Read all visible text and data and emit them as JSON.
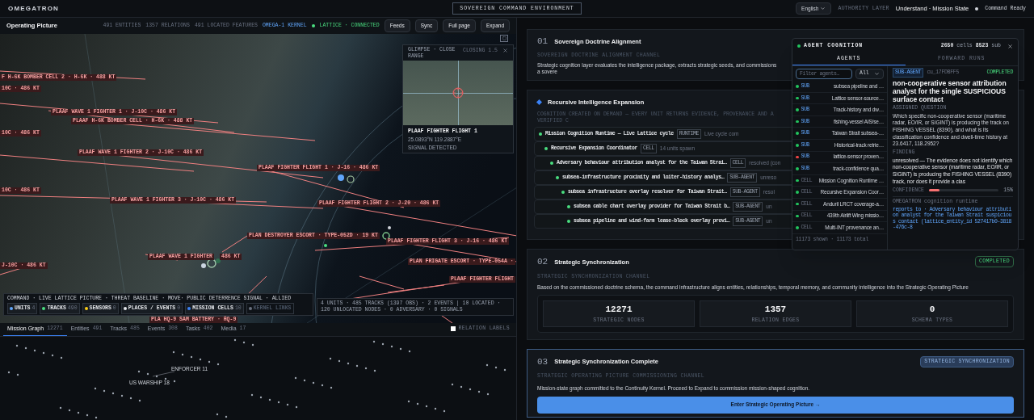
{
  "app": {
    "name": "OMEGATRON",
    "environment": "SOVEREIGN COMMAND ENVIRONMENT",
    "language": "English",
    "authority_label": "AUTHORITY LAYER",
    "authority_value": "Understand · Mission State",
    "status": "Command Ready"
  },
  "operating_picture": {
    "title": "Operating Picture",
    "stats": [
      "491 ENTITIES",
      "1357 RELATIONS",
      "491 LOCATED FEATURES"
    ],
    "kernel": "OMEGA-1 KERNEL",
    "lattice": "LATTICE · CONNECTED",
    "buttons": [
      "Feeds",
      "Sync",
      "Full page",
      "Expand"
    ]
  },
  "map": {
    "track_labels": [
      "F H-6K BOMBER CELL 2 · H-6K · 488 KT",
      "10C · 486 KT",
      "PLAAF WAVE 1 FIGHTER 1 · J-10C · 486 KT",
      "PLAAF H-6K BOMBER CELL · H-6K · 488 KT",
      "10C · 486 KT",
      "PLAAF WAVE 1 FIGHTER 2 · J-10C · 486 KT",
      "PLAAF FIGHTER FLIGHT 1 · J-16 · 486 KT",
      "10C · 486 KT",
      "PLAAF WAVE 1 FIGHTER 3 · J-10C · 486 KT",
      "PLAAF FIGHTER FLIGHT 2 · J-20 · 486 KT",
      "PLAN DESTROYER ESCORT · TYPE-052D · 19 KT",
      "PLAAF FIGHTER FLIGHT 3 · J-16 · 486 KT",
      "PLAAF WAVE 1 FIGHTER",
      "486 KT",
      "PLAN FRIGATE ESCORT · TYPE-054A ·",
      "PLAAF FIGHTER FLIGHT",
      "J-10C · 486 KT",
      "PLA HQ-9 SAM BATTERY · HQ-9"
    ],
    "glimpse": {
      "title": "GLIMPSE · CLOSE RANGE",
      "closing": "CLOSING 1.5",
      "target": "PLAAF FIGHTER FLIGHT 1",
      "coords": "25.0893°N 119.2887°E",
      "signal": "SIGNAL DETECTED"
    },
    "legend": {
      "banner": "COMMAND · LIVE LATTICE PICTURE · THREAT BASELINE · MOVE· PUBLIC DETERRENCE SIGNAL · ALLIED",
      "chips": [
        {
          "label": "UNITS",
          "count": "4",
          "color": "#60a5fa",
          "enabled": true
        },
        {
          "label": "TRACKS",
          "count": "490",
          "color": "#4ade80",
          "enabled": true
        },
        {
          "label": "SENSORS",
          "count": "0",
          "color": "#facc15",
          "enabled": true
        },
        {
          "label": "PLACES / EVENTS",
          "count": "0",
          "color": "#e5e7eb",
          "enabled": true
        },
        {
          "label": "MISSION CELLS",
          "count": "10",
          "color": "#3b82f6",
          "enabled": true
        },
        {
          "label": "KERNEL LINKS",
          "color": "#6b7280",
          "enabled": false
        }
      ],
      "summary": "4 UNITS · 485 TRACKS (1397 OBS) · 2 EVENTS | 10 LOCATED · 120 UNLOCATED NODES · 0 ADVERSARY · 0 SIGNALS"
    }
  },
  "graph": {
    "tabs": [
      {
        "label": "Mission Graph",
        "count": "12271",
        "selected": true
      },
      {
        "label": "Entities",
        "count": "491",
        "selected": false
      },
      {
        "label": "Tracks",
        "count": "485",
        "selected": false
      },
      {
        "label": "Events",
        "count": "308",
        "selected": false
      },
      {
        "label": "Tasks",
        "count": "402",
        "selected": false
      },
      {
        "label": "Media",
        "count": "17",
        "selected": false
      }
    ],
    "relation_labels": {
      "label": "RELATION LABELS",
      "checked": false
    },
    "node_labels": [
      "ENFORCER 11",
      "US WARSHIP 18"
    ]
  },
  "doctrine": {
    "number": "01",
    "title": "Sovereign Doctrine Alignment",
    "channel": "SOVEREIGN DOCTRINE ALIGNMENT CHANNEL",
    "text": "Strategic cognition layer evaluates the intelligence package, extracts strategic seeds, and commissions a sovere"
  },
  "expansion": {
    "title": "Recursive Intelligence Expansion",
    "subtitle": "COGNITION CREATED ON DEMAND — EVERY UNIT RETURNS EVIDENCE, PROVENANCE AND A VERIFIED C",
    "tree": [
      {
        "name": "Mission Cognition Runtime — Live Lattice cycle",
        "badge": "RUNTIME",
        "status": "Live cycle com",
        "children": [
          {
            "name": "Recursive Expansion Coordinator",
            "badge": "CELL",
            "status": "14 units spawn",
            "children": [
              {
                "name": "Adversary behaviour attribution analyst for the Taiwan Strai…",
                "badge": "CELL",
                "status": "resolved (con",
                "children": [
                  {
                    "name": "subsea-infrastructure proximity and loiter-history analys…",
                    "badge": "SUB-AGENT",
                    "status": "unreso",
                    "children": [
                      {
                        "name": "subsea infrastructure overlay resolver for Taiwan Strait…",
                        "badge": "SUB-AGENT",
                        "status": "resol",
                        "children": [
                          {
                            "name": "subsea cable chart overlay provider for Taiwan Strait b…",
                            "badge": "SUB-AGENT",
                            "status": "un"
                          },
                          {
                            "name": "subsea pipeline and wind-farm lease-block overlay provi…",
                            "badge": "SUB-AGENT",
                            "status": "un"
                          }
                        ]
                      }
                    ]
                  }
                ]
              }
            ]
          }
        ]
      }
    ]
  },
  "agent_cognition": {
    "title": "AGENT COGNITION",
    "cells": "2650",
    "cells_label": "cells",
    "sub": "8523",
    "sub_label": "sub",
    "tabs": [
      {
        "label": "AGENTS",
        "selected": true
      },
      {
        "label": "FORWARD RUNS",
        "selected": false
      }
    ],
    "filter": {
      "placeholder": "Filter agents…",
      "value": "All"
    },
    "agents": [
      {
        "kind": "SUB",
        "name": "subsea pipeline and …",
        "color": "#22c55e"
      },
      {
        "kind": "SUB",
        "name": "Lattice sensor-source…",
        "color": "#22c55e"
      },
      {
        "kind": "SUB",
        "name": "Track-history and dw…",
        "color": "#22c55e"
      },
      {
        "kind": "SUB",
        "name": "fishing-vessel AIS/se…",
        "color": "#22c55e"
      },
      {
        "kind": "SUB",
        "name": "Taiwan Strait subsea-…",
        "color": "#22c55e"
      },
      {
        "kind": "SUB",
        "name": "Historical-track retrie…",
        "color": "#22c55e"
      },
      {
        "kind": "SUB",
        "name": "lattice-sensor proven…",
        "color": "#ef4444"
      },
      {
        "kind": "SUB",
        "name": "track-confidence qua…",
        "color": "#22c55e"
      },
      {
        "kind": "CELL",
        "name": "Mission Cognition Runtime …",
        "color": "#22c55e"
      },
      {
        "kind": "CELL",
        "name": "Recursive Expansion Coor…",
        "color": "#22c55e"
      },
      {
        "kind": "CELL",
        "name": "Anduril LRCT coverage-a…",
        "color": "#22c55e"
      },
      {
        "kind": "CELL",
        "name": "439th Airlift Wing missio…",
        "color": "#22c55e"
      },
      {
        "kind": "CELL",
        "name": "Multi-INT provenance an…",
        "color": "#22c55e"
      }
    ],
    "footer": "11173 shown · 11173 total",
    "detail": {
      "badge": "SUB-AGENT",
      "id": "cu_17FDBFF5",
      "status": "COMPLETED",
      "title": "non-cooperative sensor attribution analyst for the single SUSPICIOUS surface contact",
      "question_label": "ASSIGNED QUESTION",
      "question": "Which specific non-cooperative sensor (maritime radar, EO/IR, or SIGINT) is producing the track on FISHING VESSEL (8390), and what is its classification confidence and dwell-time history at 23.6417, 118.2952?",
      "finding_label": "FINDING",
      "finding": "unresolved — The evidence does not identify which non-cooperative sensor (maritime radar, EO/IR, or SIGINT) is producing the FISHING VESSEL (8390) track, nor does it provide a clas",
      "confidence_label": "CONFIDENCE",
      "confidence": {
        "level": 0.15,
        "reading": "15%"
      },
      "runtime": "OMEGATRON cognition runtime",
      "reports": "reports to · Adversary behaviour attribution analyst for the Taiwan Strait suspicious contact (lattice_entity_id 527417b0-3818-476c-8"
    }
  },
  "synchronization": {
    "number": "02",
    "title": "Strategic Synchronization",
    "badge": "COMPLETED",
    "channel": "STRATEGIC SYNCHRONIZATION CHANNEL",
    "text": "Based on the commissioned doctrine schema, the command infrastructure aligns entities, relationships, temporal memory, and community intelligence into the Strategic Operating Picture",
    "stats": [
      {
        "value": "12271",
        "label": "STRATEGIC NODES"
      },
      {
        "value": "1357",
        "label": "RELATION EDGES"
      },
      {
        "value": "0",
        "label": "SCHEMA TYPES"
      }
    ]
  },
  "complete": {
    "number": "03",
    "title": "Strategic Synchronization Complete",
    "badge": "STRATEGIC SYNCHRONIZATION",
    "channel": "STRATEGIC OPERATING PICTURE COMMISSIONING CHANNEL",
    "text": "Mission-state graph committed to the Continuity Kernel. Proceed to Expand to commission mission-shaped cognition.",
    "button": "Enter Strategic Operating Picture →"
  }
}
